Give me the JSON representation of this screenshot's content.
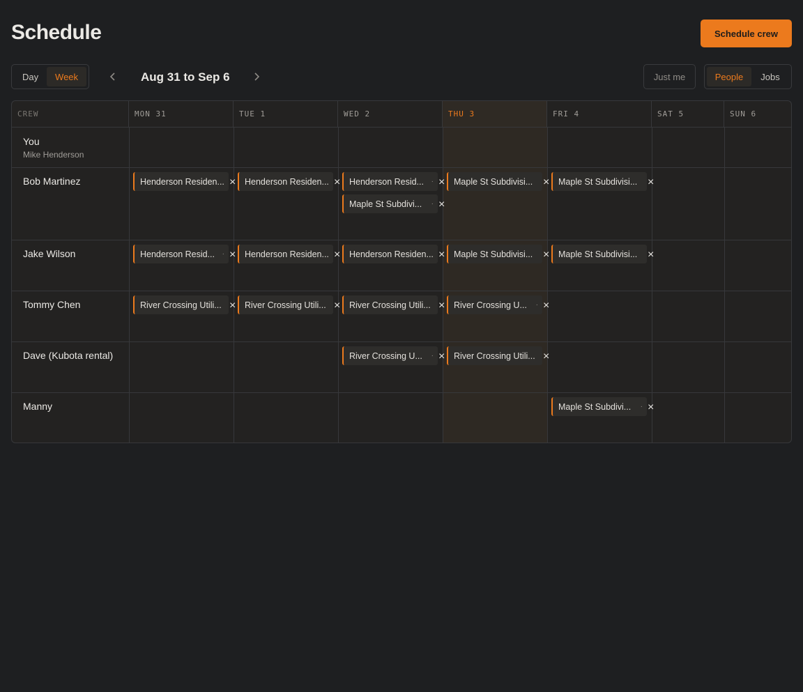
{
  "header": {
    "title": "Schedule",
    "primary_action": "Schedule crew"
  },
  "toolbar": {
    "view_options": [
      "Day",
      "Week"
    ],
    "active_view": "Week",
    "prev_icon": "chevron-left-icon",
    "next_icon": "chevron-right-icon",
    "range_label": "Aug 31 to Sep 6",
    "filter_label": "Just me",
    "mode_options": [
      "People",
      "Jobs"
    ],
    "active_mode": "People"
  },
  "grid": {
    "crew_header": "CREW",
    "days": [
      "MON 31",
      "TUE 1",
      "WED 2",
      "THU 3",
      "FRI 4",
      "SAT 5",
      "SUN 6"
    ],
    "today_index": 3,
    "rows": [
      {
        "name": "You",
        "subtitle": "Mike Henderson",
        "assignments": []
      },
      {
        "name": "Bob Martinez",
        "assignments": [
          {
            "day": 0,
            "slot": 0,
            "label": "Henderson Residen...",
            "dot": false
          },
          {
            "day": 1,
            "slot": 0,
            "label": "Henderson Residen...",
            "dot": false
          },
          {
            "day": 2,
            "slot": 0,
            "label": "Henderson Resid...",
            "dot": true
          },
          {
            "day": 2,
            "slot": 1,
            "label": "Maple St Subdivi...",
            "dot": true
          },
          {
            "day": 3,
            "slot": 0,
            "label": "Maple St Subdivisi...",
            "dot": false
          },
          {
            "day": 4,
            "slot": 0,
            "label": "Maple St Subdivisi...",
            "dot": false
          }
        ]
      },
      {
        "name": "Jake Wilson",
        "assignments": [
          {
            "day": 0,
            "slot": 0,
            "label": "Henderson Resid...",
            "dot": true
          },
          {
            "day": 1,
            "slot": 0,
            "label": "Henderson Residen...",
            "dot": false
          },
          {
            "day": 2,
            "slot": 0,
            "label": "Henderson Residen...",
            "dot": false
          },
          {
            "day": 3,
            "slot": 0,
            "label": "Maple St Subdivisi...",
            "dot": false
          },
          {
            "day": 4,
            "slot": 0,
            "label": "Maple St Subdivisi...",
            "dot": false
          }
        ]
      },
      {
        "name": "Tommy Chen",
        "assignments": [
          {
            "day": 0,
            "slot": 0,
            "label": "River Crossing Utili...",
            "dot": false
          },
          {
            "day": 1,
            "slot": 0,
            "label": "River Crossing Utili...",
            "dot": false
          },
          {
            "day": 2,
            "slot": 0,
            "label": "River Crossing Utili...",
            "dot": false
          },
          {
            "day": 3,
            "slot": 0,
            "label": "River Crossing U...",
            "dot": true
          }
        ]
      },
      {
        "name": "Dave (Kubota rental)",
        "assignments": [
          {
            "day": 2,
            "slot": 0,
            "label": "River Crossing U...",
            "dot": true
          },
          {
            "day": 3,
            "slot": 0,
            "label": "River Crossing Utili...",
            "dot": false
          }
        ]
      },
      {
        "name": "Manny",
        "assignments": [
          {
            "day": 4,
            "slot": 0,
            "label": "Maple St Subdivi...",
            "dot": true
          }
        ]
      }
    ],
    "remove_glyph": "×",
    "dot_glyph": "·"
  },
  "colors": {
    "accent": "#ec7a1d",
    "background": "#1e1f21",
    "today_column": "#2e2923"
  }
}
